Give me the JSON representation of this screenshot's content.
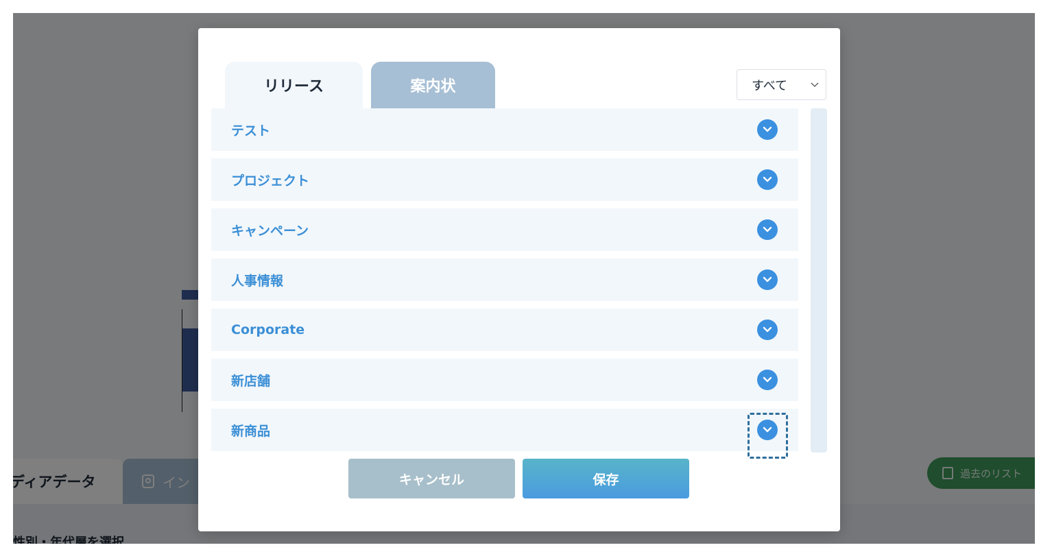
{
  "background": {
    "tabs": [
      {
        "label": "ディアデータ"
      },
      {
        "label": "イン"
      }
    ],
    "section_label": "性別・年代層を選択",
    "history_button_label": "過去のリスト"
  },
  "modal": {
    "tabs": [
      {
        "label": "リリース",
        "active": true
      },
      {
        "label": "案内状",
        "active": false
      }
    ],
    "filter": {
      "selected": "すべて"
    },
    "categories": [
      {
        "label": "テスト",
        "icon": "chevron-down-icon"
      },
      {
        "label": "プロジェクト",
        "icon": "chevron-down-icon"
      },
      {
        "label": "キャンペーン",
        "icon": "chevron-down-icon"
      },
      {
        "label": "人事情報",
        "icon": "chevron-down-icon"
      },
      {
        "label": "Corporate",
        "icon": "chevron-down-icon"
      },
      {
        "label": "新店舗",
        "icon": "chevron-down-icon"
      },
      {
        "label": "新商品",
        "icon": "chevron-down-icon",
        "focused": true
      }
    ],
    "buttons": {
      "cancel": "キャンセル",
      "save": "保存"
    }
  },
  "colors": {
    "accent": "#3b90e0",
    "tab_inactive": "#a7bfd5",
    "row_bg": "#f2f7fb",
    "focus_ring": "#2e6e9c"
  }
}
